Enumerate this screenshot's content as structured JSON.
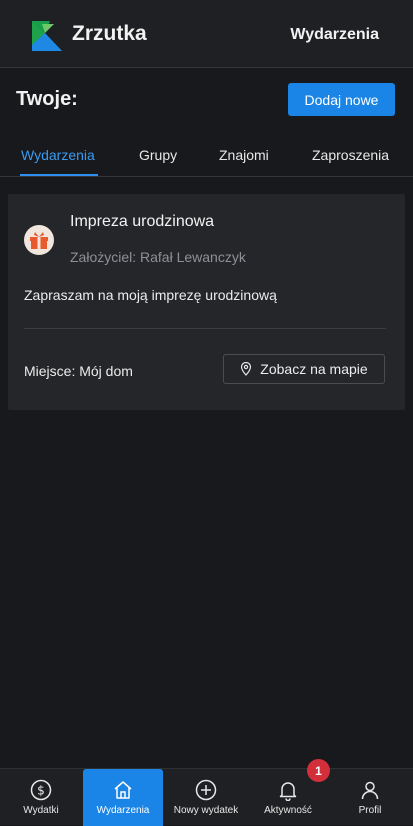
{
  "header": {
    "brand": "Zrzutka",
    "nav_link": "Wydarzenia"
  },
  "section": {
    "title": "Twoje:",
    "add_button": "Dodaj nowe"
  },
  "tabs": [
    {
      "label": "Wydarzenia",
      "active": true
    },
    {
      "label": "Grupy",
      "active": false
    },
    {
      "label": "Znajomi",
      "active": false
    },
    {
      "label": "Zaproszenia",
      "active": false
    }
  ],
  "event": {
    "title": "Impreza urodzinowa",
    "founder": "Założyciel: Rafał Lewanczyk",
    "description": "Zapraszam na moją imprezę urodzinową",
    "place": "Miejsce: Mój dom",
    "map_button": "Zobacz na mapie"
  },
  "bottom_nav": [
    {
      "label": "Wydatki",
      "icon": "dollar-circle-icon",
      "active": false
    },
    {
      "label": "Wydarzenia",
      "icon": "home-icon",
      "active": true
    },
    {
      "label": "Nowy wydatek",
      "icon": "plus-circle-icon",
      "active": false
    },
    {
      "label": "Aktywność",
      "icon": "bell-icon",
      "active": false
    },
    {
      "label": "Profil",
      "icon": "user-icon",
      "active": false
    }
  ],
  "notifications_count": "1",
  "colors": {
    "accent": "#1a85e6",
    "background": "#18191c",
    "card": "#25262a",
    "badge": "#d32f3a"
  }
}
